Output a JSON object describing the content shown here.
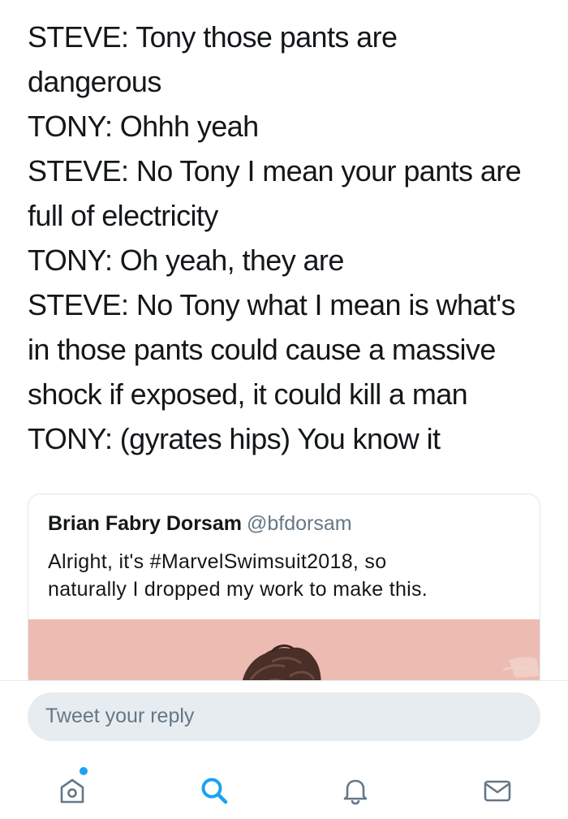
{
  "tweet": {
    "lines": [
      "STEVE: Tony those pants are",
      "dangerous",
      "TONY: Ohhh yeah",
      "STEVE: No Tony I mean your pants are",
      "full of electricity",
      "TONY: Oh yeah, they are",
      "STEVE: No Tony what I mean is what's",
      "in those pants could cause a massive",
      "shock if exposed, it could kill a man",
      "TONY: (gyrates hips) You know it"
    ]
  },
  "quoted_tweet": {
    "author_name": "Brian Fabry Dorsam",
    "author_handle": "@bfdorsam",
    "text_lines": [
      "Alright, it's #MarvelSwimsuit2018, so",
      "naturally I dropped my work to make this."
    ],
    "image_background": "#ecbcb2"
  },
  "reply": {
    "placeholder": "Tweet your reply"
  },
  "tab_bar": {
    "tabs": [
      {
        "name": "home",
        "icon": "home-icon",
        "active": false,
        "has_notification_dot": true
      },
      {
        "name": "search",
        "icon": "search-icon",
        "active": true
      },
      {
        "name": "notifications",
        "icon": "bell-icon",
        "active": false
      },
      {
        "name": "messages",
        "icon": "envelope-icon",
        "active": false
      }
    ]
  },
  "colors": {
    "text_primary": "#14171a",
    "text_secondary": "#657786",
    "accent": "#1da1f2",
    "icon_inactive": "#657786",
    "border": "#e1e8ed",
    "reply_background": "#e6ecf0"
  }
}
